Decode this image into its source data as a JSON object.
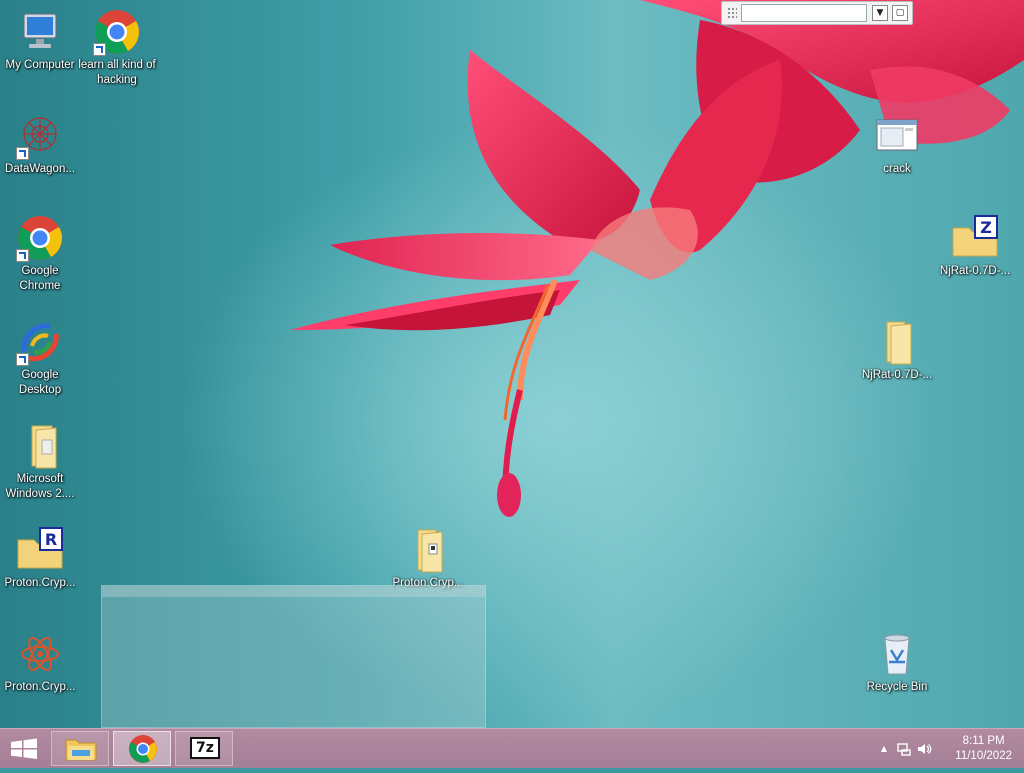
{
  "desktop": {
    "icons_left": [
      {
        "label": "My Computer",
        "icon": "computer-icon"
      },
      {
        "label": "DataWagon...",
        "icon": "datawagon-icon"
      },
      {
        "label": "Google Chrome",
        "icon": "chrome-icon"
      },
      {
        "label": "Google Desktop",
        "icon": "google-desktop-icon"
      },
      {
        "label": "Microsoft Windows 2....",
        "icon": "folder-icon"
      },
      {
        "label": "Proton.Cryp...",
        "icon": "winrar-archive-icon"
      },
      {
        "label": "Proton.Cryp...",
        "icon": "atom-icon"
      }
    ],
    "icon_chrome_shortcut": {
      "label": "learn all kind of hacking",
      "icon": "chrome-icon"
    },
    "icon_folder_center": {
      "label": "Proton.Cryp...",
      "icon": "folder-icon"
    },
    "icons_right": [
      {
        "label": "crack",
        "icon": "window-app-icon"
      },
      {
        "label": "NjRat-0.7D-...",
        "icon": "zip-folder-icon"
      },
      {
        "label": "NjRat-0.7D-...",
        "icon": "folder-icon"
      },
      {
        "label": "Recycle Bin",
        "icon": "recycle-bin-icon"
      }
    ]
  },
  "float_toolbar": {
    "value": "",
    "dropdown_icon": "chevron-down-icon",
    "restore_icon": "window-restore-icon"
  },
  "taskbar": {
    "start_icon": "windows-logo-icon",
    "pinned": [
      {
        "name": "file-explorer",
        "icon": "folder-icon"
      },
      {
        "name": "chrome",
        "icon": "chrome-icon",
        "active": true
      },
      {
        "name": "7zip",
        "icon": "7zip-icon",
        "text": "7z"
      }
    ],
    "tray": {
      "chevron": "▲",
      "network_icon": "network-icon",
      "volume_icon": "speaker-icon"
    },
    "clock": {
      "time": "8:11 PM",
      "date": "11/10/2022"
    }
  },
  "colors": {
    "taskbar": "#a88299",
    "wallpaper": "#3f9fa8",
    "flower": "#e0244a"
  }
}
